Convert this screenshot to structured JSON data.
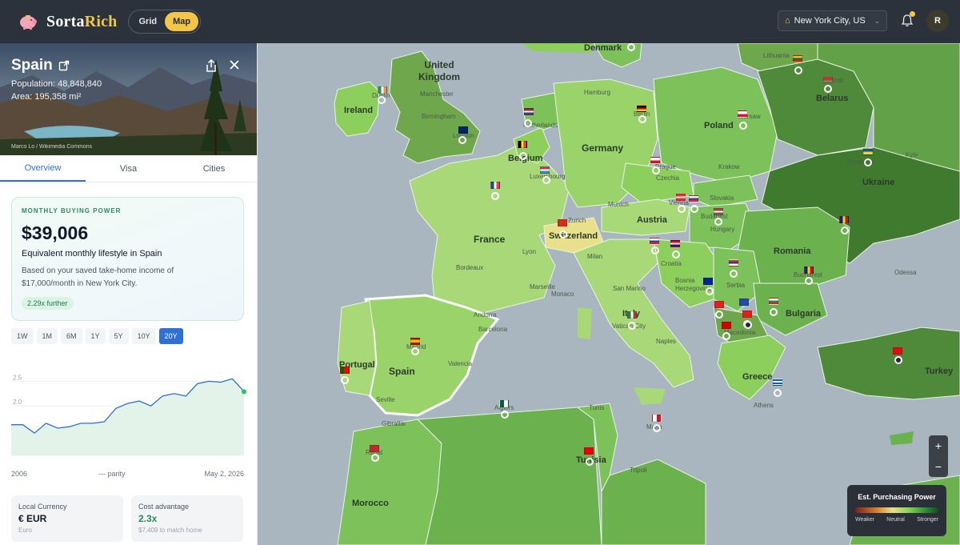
{
  "app": {
    "brand_part1": "Sorta",
    "brand_part2": "Rich"
  },
  "view_toggle": {
    "grid": "Grid",
    "map": "Map"
  },
  "location": {
    "label": "New York City, US"
  },
  "user": {
    "initial": "R"
  },
  "country": {
    "name": "Spain",
    "population": "Population: 48,848,840",
    "area": "Area: 195,358 mi²",
    "credit": "Marco Lo / Wikimedia Commons"
  },
  "tabs": [
    "Overview",
    "Visa",
    "Cities"
  ],
  "buying_power": {
    "kicker": "MONTHLY BUYING POWER",
    "amount": "$39,006",
    "subtitle": "Equivalent monthly lifestyle in Spain",
    "description": "Based on your saved take-home income of $17,000/month in New York City.",
    "badge": "2.29x further"
  },
  "ranges": [
    "1W",
    "1M",
    "6M",
    "1Y",
    "5Y",
    "10Y",
    "20Y"
  ],
  "active_range": "20Y",
  "chart_data": {
    "type": "area",
    "x_start": "2006",
    "x_end": "May 2, 2026",
    "parity_label": "--- parity",
    "y_ticks": [
      "2.5",
      "2.0",
      "1.5",
      "1.0"
    ],
    "ylim": [
      1.0,
      2.7
    ],
    "values": [
      1.62,
      1.62,
      1.45,
      1.65,
      1.55,
      1.58,
      1.65,
      1.65,
      1.68,
      1.95,
      2.05,
      2.1,
      2.0,
      2.2,
      2.25,
      2.2,
      2.45,
      2.5,
      2.48,
      2.55,
      2.29
    ]
  },
  "stats": {
    "currency": {
      "title": "Local Currency",
      "value": "€ EUR",
      "sub": "Euro"
    },
    "cost": {
      "title": "Cost advantage",
      "value": "2.3x",
      "sub": "$7,409 to match home"
    }
  },
  "map": {
    "countries": [
      "United Kingdom",
      "Ireland",
      "France",
      "Belgium",
      "Germany",
      "Poland",
      "Belarus",
      "Ukraine",
      "Switzerland",
      "Austria",
      "Romania",
      "Spain",
      "Portugal",
      "Italy",
      "Bulgaria",
      "Serbia",
      "Croatia",
      "Hungary",
      "Slovakia",
      "Czechia",
      "Greece",
      "Turkey",
      "Morocco",
      "Tunisia",
      "Macedonia",
      "Bosnia Herzegovina",
      "Lithuania",
      "Denmark"
    ],
    "cities": [
      "Dublin",
      "London",
      "Manchester",
      "Birmingham",
      "Netherlands",
      "Luxembourg",
      "Hamburg",
      "Berlin",
      "Prague",
      "Vienna",
      "Budapest",
      "Bucharest",
      "Madrid",
      "Lyon",
      "Bordeaux",
      "Monaco",
      "San Marino",
      "Vatican City",
      "Naples",
      "Barcelona",
      "Andorra",
      "Seville",
      "Gibraltar",
      "Rabat",
      "Algiers",
      "Tunis",
      "Malta",
      "Tripoli",
      "Zurich",
      "Milan",
      "Munich",
      "Krakow",
      "Warsaw",
      "Zhytomyr",
      "Odessa",
      "Minsk",
      "Kyiv",
      "Athens",
      "Valencia",
      "Marseille"
    ]
  },
  "legend": {
    "title": "Est. Purchasing Power",
    "weaker": "Weaker",
    "neutral": "Neutral",
    "stronger": "Stronger"
  },
  "colors": {
    "accent": "#f3c646",
    "active_blue": "#2f6fd8",
    "positive": "#2d8a5d",
    "sea": "#a9b6bf"
  }
}
